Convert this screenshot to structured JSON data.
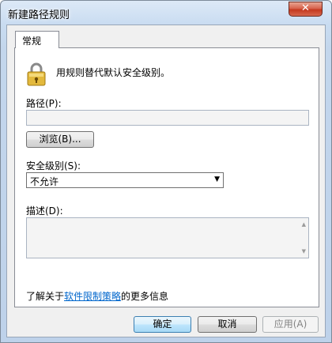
{
  "window": {
    "title": "新建路径规则",
    "close_glyph": "✕"
  },
  "tabs": [
    {
      "label": "常规"
    }
  ],
  "general": {
    "description": "用规则替代默认安全级别。",
    "path_label": "路径(P):",
    "path_value": "",
    "browse_label": "浏览(B)...",
    "security_level_label": "安全级别(S):",
    "security_level_selected": "不允许",
    "dropdown_arrow": "▼",
    "notes_label": "描述(D):",
    "notes_value": "",
    "scroll_up": "▲",
    "scroll_down": "▼",
    "info_prefix": "了解关于",
    "info_link": "软件限制策略",
    "info_suffix": "的更多信息"
  },
  "buttons": {
    "ok": "确定",
    "cancel": "取消",
    "apply": "应用(A)"
  },
  "icons": {
    "lock": "lock-icon"
  }
}
